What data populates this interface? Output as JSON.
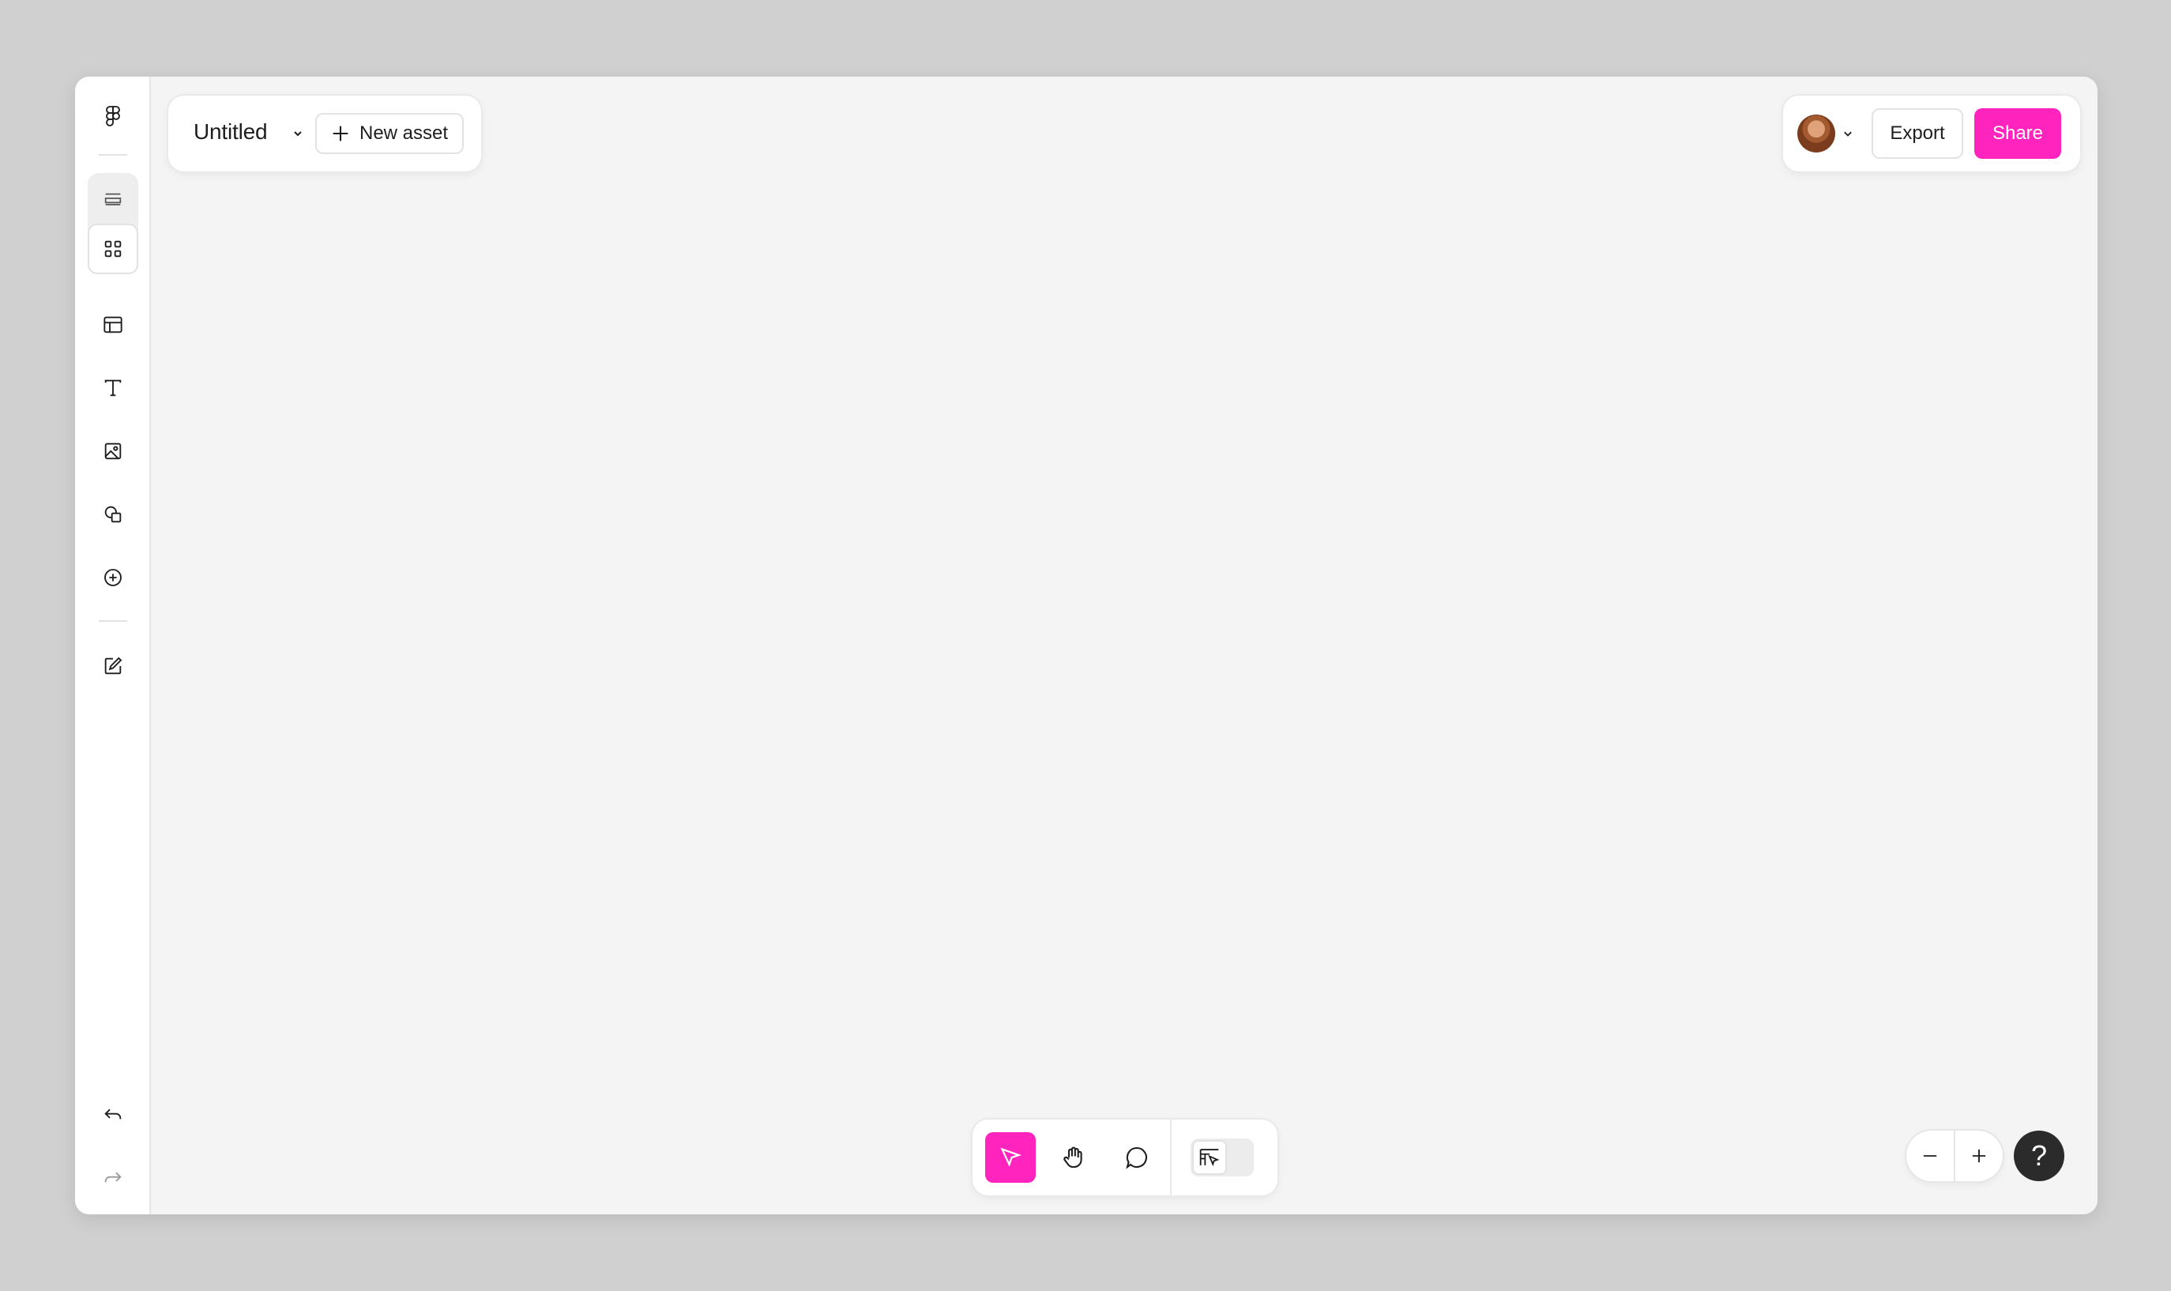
{
  "file": {
    "title": "Untitled",
    "new_asset_label": "New asset"
  },
  "topbar": {
    "export_label": "Export",
    "share_label": "Share"
  },
  "help": {
    "label": "?"
  },
  "colors": {
    "accent": "#ff24bd",
    "canvas": "#f4f4f4",
    "help_bg": "#2b2b2b"
  },
  "sidebar": {
    "icons": [
      "figma-logo-icon",
      "layers-icon",
      "assets-grid-icon",
      "layout-template-icon",
      "text-icon",
      "image-icon",
      "shapes-icon",
      "add-circle-icon",
      "edit-icon",
      "undo-icon",
      "redo-icon"
    ]
  },
  "toolbar": {
    "tools": [
      "select-tool",
      "hand-tool",
      "comment-tool",
      "dev-mode-toggle"
    ],
    "active_tool": "select-tool"
  }
}
